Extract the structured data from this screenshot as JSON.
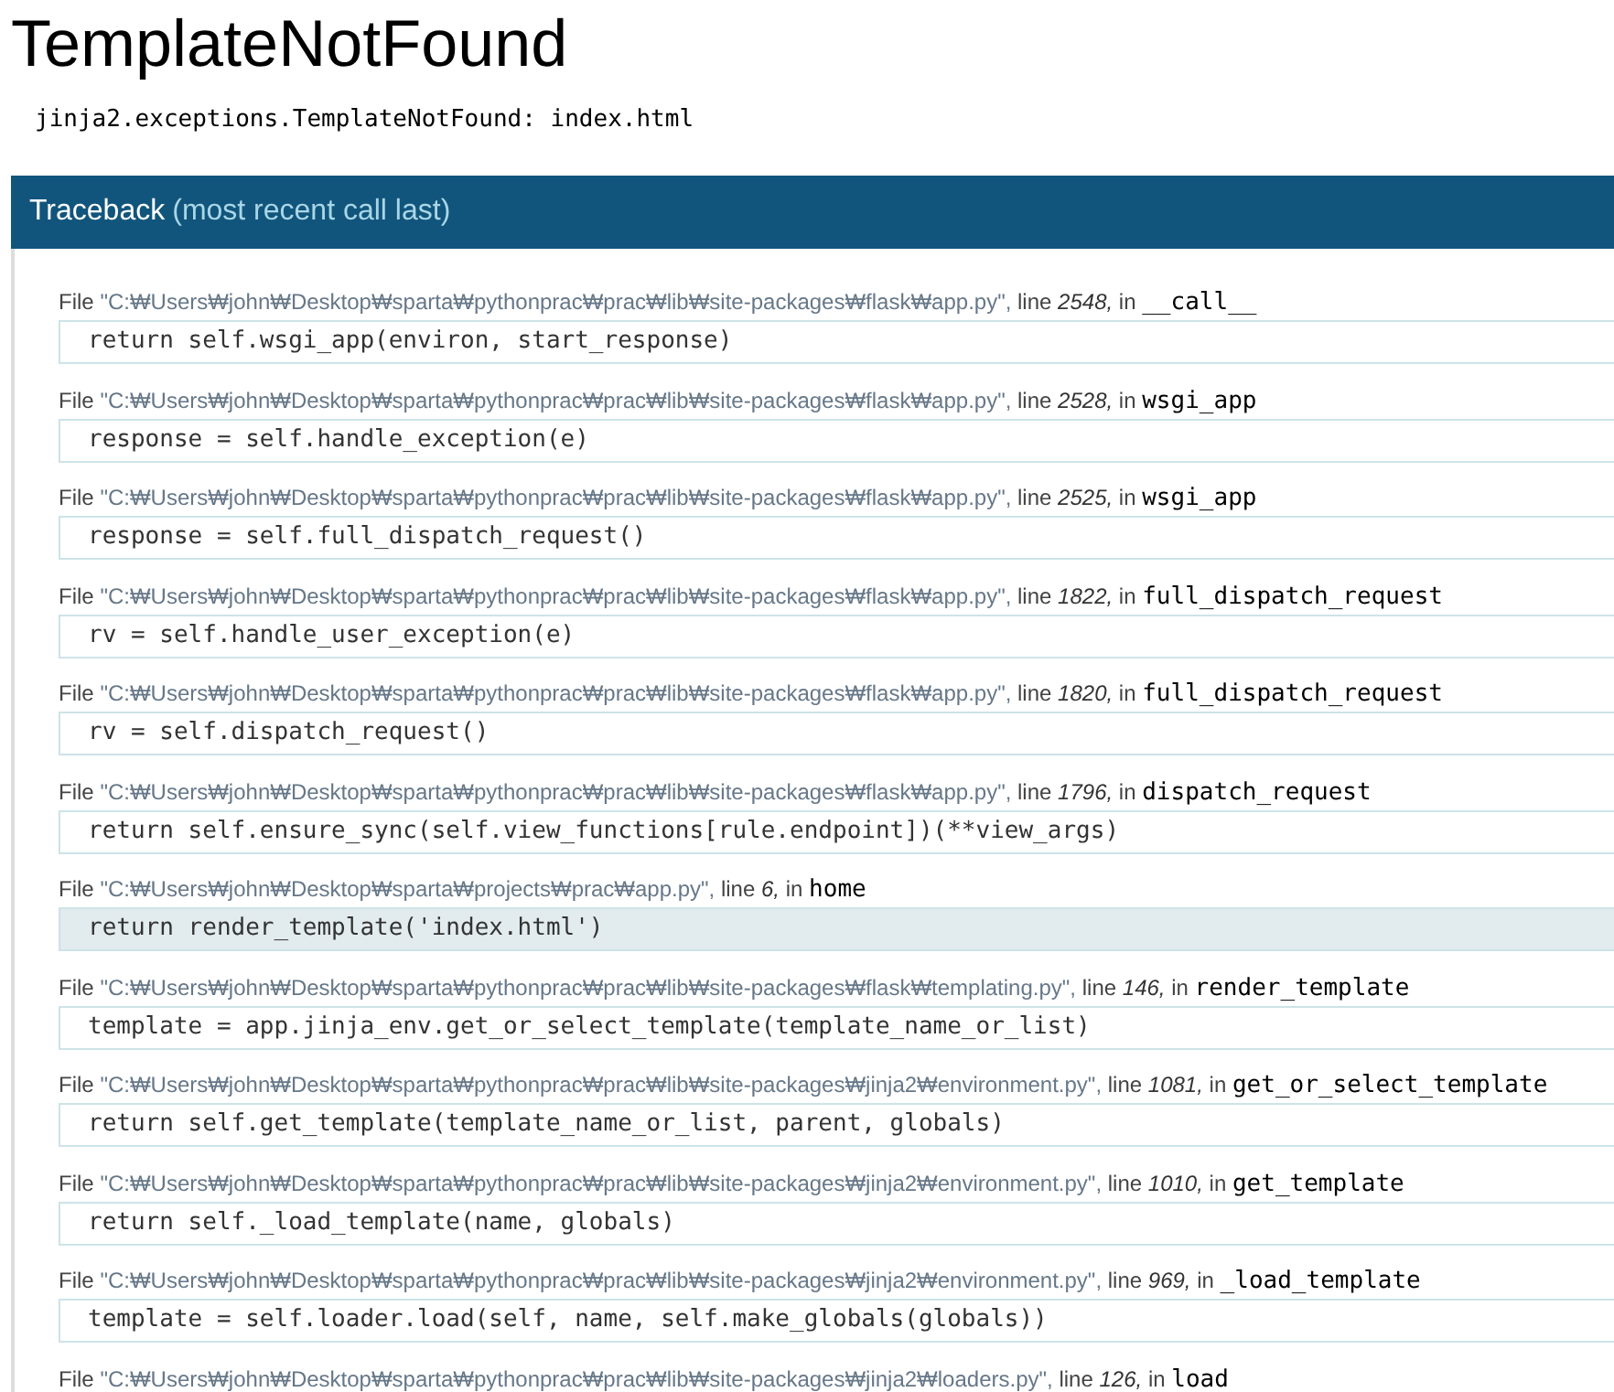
{
  "title": "TemplateNotFound",
  "exception": "jinja2.exceptions.TemplateNotFound: index.html",
  "traceback": {
    "heading": "Traceback",
    "note": "(most recent call last)",
    "frames": [
      {
        "file_label": "File",
        "path": "\"C:₩Users₩john₩Desktop₩sparta₩pythonprac₩prac₩lib₩site-packages₩flask₩app.py\",",
        "line_label": "line",
        "line": "2548,",
        "in_label": "in",
        "function": "__call__",
        "code": "return self.wsgi_app(environ, start_response)",
        "current": false
      },
      {
        "file_label": "File",
        "path": "\"C:₩Users₩john₩Desktop₩sparta₩pythonprac₩prac₩lib₩site-packages₩flask₩app.py\",",
        "line_label": "line",
        "line": "2528,",
        "in_label": "in",
        "function": "wsgi_app",
        "code": "response = self.handle_exception(e)",
        "current": false
      },
      {
        "file_label": "File",
        "path": "\"C:₩Users₩john₩Desktop₩sparta₩pythonprac₩prac₩lib₩site-packages₩flask₩app.py\",",
        "line_label": "line",
        "line": "2525,",
        "in_label": "in",
        "function": "wsgi_app",
        "code": "response = self.full_dispatch_request()",
        "current": false
      },
      {
        "file_label": "File",
        "path": "\"C:₩Users₩john₩Desktop₩sparta₩pythonprac₩prac₩lib₩site-packages₩flask₩app.py\",",
        "line_label": "line",
        "line": "1822,",
        "in_label": "in",
        "function": "full_dispatch_request",
        "code": "rv = self.handle_user_exception(e)",
        "current": false
      },
      {
        "file_label": "File",
        "path": "\"C:₩Users₩john₩Desktop₩sparta₩pythonprac₩prac₩lib₩site-packages₩flask₩app.py\",",
        "line_label": "line",
        "line": "1820,",
        "in_label": "in",
        "function": "full_dispatch_request",
        "code": "rv = self.dispatch_request()",
        "current": false
      },
      {
        "file_label": "File",
        "path": "\"C:₩Users₩john₩Desktop₩sparta₩pythonprac₩prac₩lib₩site-packages₩flask₩app.py\",",
        "line_label": "line",
        "line": "1796,",
        "in_label": "in",
        "function": "dispatch_request",
        "code": "return self.ensure_sync(self.view_functions[rule.endpoint])(**view_args)",
        "current": false
      },
      {
        "file_label": "File",
        "path": "\"C:₩Users₩john₩Desktop₩sparta₩projects₩prac₩app.py\",",
        "line_label": "line",
        "line": "6,",
        "in_label": "in",
        "function": "home",
        "code": "return render_template('index.html')",
        "current": true
      },
      {
        "file_label": "File",
        "path": "\"C:₩Users₩john₩Desktop₩sparta₩pythonprac₩prac₩lib₩site-packages₩flask₩templating.py\",",
        "line_label": "line",
        "line": "146,",
        "in_label": "in",
        "function": "render_template",
        "code": "template = app.jinja_env.get_or_select_template(template_name_or_list)",
        "current": false
      },
      {
        "file_label": "File",
        "path": "\"C:₩Users₩john₩Desktop₩sparta₩pythonprac₩prac₩lib₩site-packages₩jinja2₩environment.py\",",
        "line_label": "line",
        "line": "1081,",
        "in_label": "in",
        "function": "get_or_select_template",
        "code": "return self.get_template(template_name_or_list, parent, globals)",
        "current": false
      },
      {
        "file_label": "File",
        "path": "\"C:₩Users₩john₩Desktop₩sparta₩pythonprac₩prac₩lib₩site-packages₩jinja2₩environment.py\",",
        "line_label": "line",
        "line": "1010,",
        "in_label": "in",
        "function": "get_template",
        "code": "return self._load_template(name, globals)",
        "current": false
      },
      {
        "file_label": "File",
        "path": "\"C:₩Users₩john₩Desktop₩sparta₩pythonprac₩prac₩lib₩site-packages₩jinja2₩environment.py\",",
        "line_label": "line",
        "line": "969,",
        "in_label": "in",
        "function": "_load_template",
        "code": "template = self.loader.load(self, name, self.make_globals(globals))",
        "current": false
      },
      {
        "file_label": "File",
        "path": "\"C:₩Users₩john₩Desktop₩sparta₩pythonprac₩prac₩lib₩site-packages₩jinja2₩loaders.py\",",
        "line_label": "line",
        "line": "126,",
        "in_label": "in",
        "function": "load"
      }
    ]
  }
}
